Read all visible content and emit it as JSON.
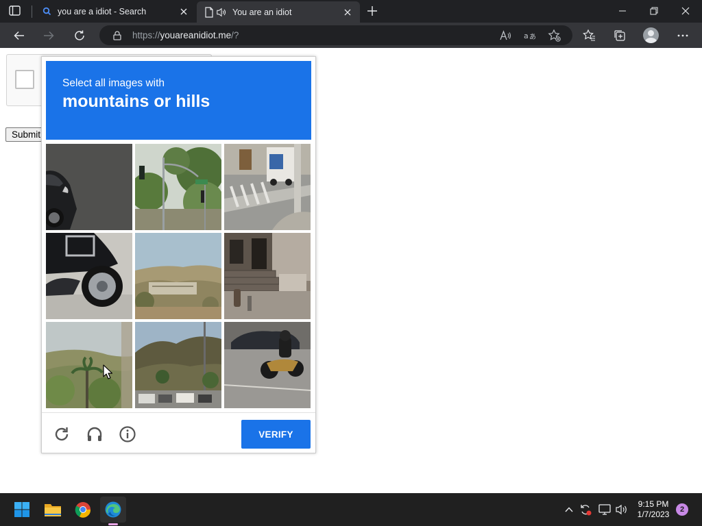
{
  "browser": {
    "tabs": [
      {
        "title": "you are a idiot - Search",
        "icon": "search-icon",
        "active": false
      },
      {
        "title": "You are an idiot",
        "icon": "page-icon",
        "audio": true,
        "active": true
      }
    ],
    "address": {
      "scheme": "https://",
      "host": "youareanidiot.me",
      "path": "/?"
    },
    "toolbar_icons": [
      "back-icon",
      "forward-icon",
      "refresh-icon",
      "read-aloud-icon",
      "translate-icon",
      "add-favorite-icon",
      "favorites-icon",
      "collections-icon",
      "profile-avatar",
      "more-icon"
    ]
  },
  "page": {
    "submit_label": "Submit"
  },
  "captcha": {
    "prompt": "Select all images with",
    "target": "mountains or hills",
    "tiles": [
      {
        "index": 1,
        "scene": "car-closeup",
        "selected": false
      },
      {
        "index": 2,
        "scene": "traffic-light-trees",
        "selected": false
      },
      {
        "index": 3,
        "scene": "street-crosswalk",
        "selected": false
      },
      {
        "index": 4,
        "scene": "scooter-wheel",
        "selected": false
      },
      {
        "index": 5,
        "scene": "hills-bridge",
        "selected": false
      },
      {
        "index": 6,
        "scene": "building-steps-hydrant",
        "selected": false
      },
      {
        "index": 7,
        "scene": "hillside-palm",
        "selected": false
      },
      {
        "index": 8,
        "scene": "mountain-road",
        "selected": false
      },
      {
        "index": 9,
        "scene": "motorcycle-road",
        "selected": false
      }
    ],
    "footer_icons": [
      "reload-icon",
      "audio-challenge-icon",
      "info-icon"
    ],
    "verify_label": "VERIFY",
    "accent_color": "#1a73e8"
  },
  "taskbar": {
    "apps": [
      "windows-start-icon",
      "file-explorer-icon",
      "chrome-icon",
      "edge-icon"
    ],
    "tray_icons": [
      "chevron-up-icon",
      "sync-icon",
      "network-icon",
      "volume-icon"
    ],
    "time": "9:15 PM",
    "date": "1/7/2023",
    "notifications": "2"
  }
}
